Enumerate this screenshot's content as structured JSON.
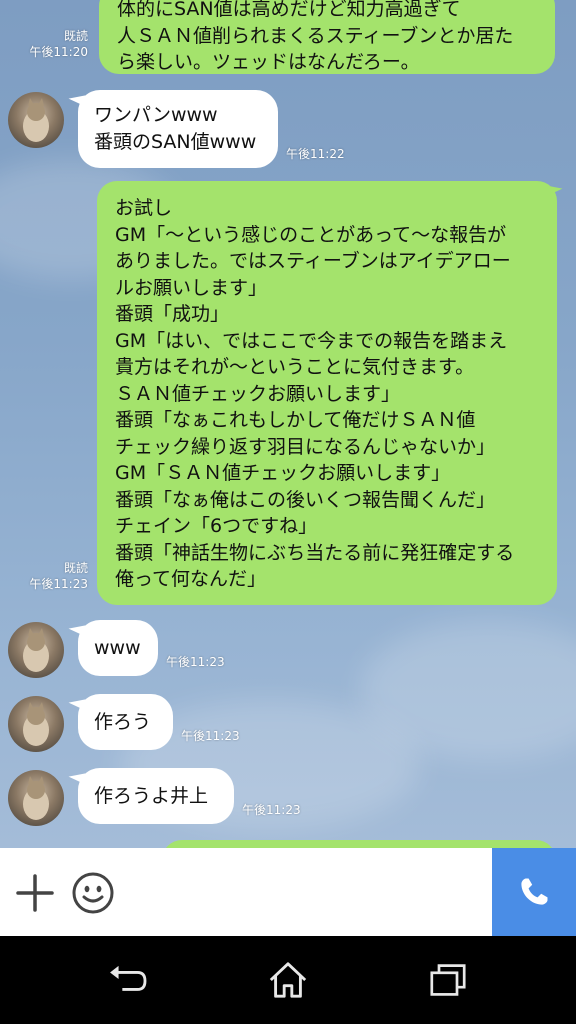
{
  "colors": {
    "outgoing_bubble": "#a4e36c",
    "incoming_bubble": "#ffffff",
    "call_button": "#4a8de6",
    "chat_background": "#87a6c9",
    "nav_bar": "#000000"
  },
  "messages": [
    {
      "id": "m1",
      "direction": "outgoing",
      "lines": [
        "体的にSAN値は高めだけど知力高過ぎて",
        "人ＳＡＮ値削られまくるスティーブンとか居た",
        "ら楽しい。ツェッドはなんだろー。"
      ],
      "read": "既読",
      "time": "午後11:20"
    },
    {
      "id": "m2",
      "direction": "incoming",
      "lines": [
        "ワンパンwww",
        "番頭のSAN値www"
      ],
      "time": "午後11:22"
    },
    {
      "id": "m3",
      "direction": "outgoing",
      "lines": [
        "お試し",
        "GM「～という感じのことがあって～な報告が",
        "ありました。ではスティーブンはアイデアロー",
        "ルお願いします」",
        "番頭「成功」",
        "GM「はい、ではここで今までの報告を踏まえ",
        "貴方はそれが～ということに気付きます。",
        "ＳＡＮ値チェックお願いします」",
        "番頭「なぁこれもしかして俺だけＳＡＮ値",
        "チェック繰り返す羽目になるんじゃないか」",
        "GM「ＳＡＮ値チェックお願いします」",
        "番頭「なぁ俺はこの後いくつ報告聞くんだ」",
        "チェイン「6つですね」",
        "番頭「神話生物にぶち当たる前に発狂確定する",
        "俺って何なんだ」"
      ],
      "read": "既読",
      "time": "午後11:23"
    },
    {
      "id": "m4",
      "direction": "incoming",
      "lines": [
        "www"
      ],
      "time": "午後11:23"
    },
    {
      "id": "m5",
      "direction": "incoming",
      "lines": [
        "作ろう"
      ],
      "time": "午後11:23"
    },
    {
      "id": "m6",
      "direction": "incoming",
      "lines": [
        "作ろうよ井上"
      ],
      "time": "午後11:23"
    }
  ],
  "input_bar": {
    "add_icon": "plus-icon",
    "emoji_icon": "smiley-icon",
    "call_icon": "phone-icon"
  },
  "nav_bar": {
    "back_icon": "back-icon",
    "home_icon": "home-icon",
    "recents_icon": "recents-icon"
  }
}
